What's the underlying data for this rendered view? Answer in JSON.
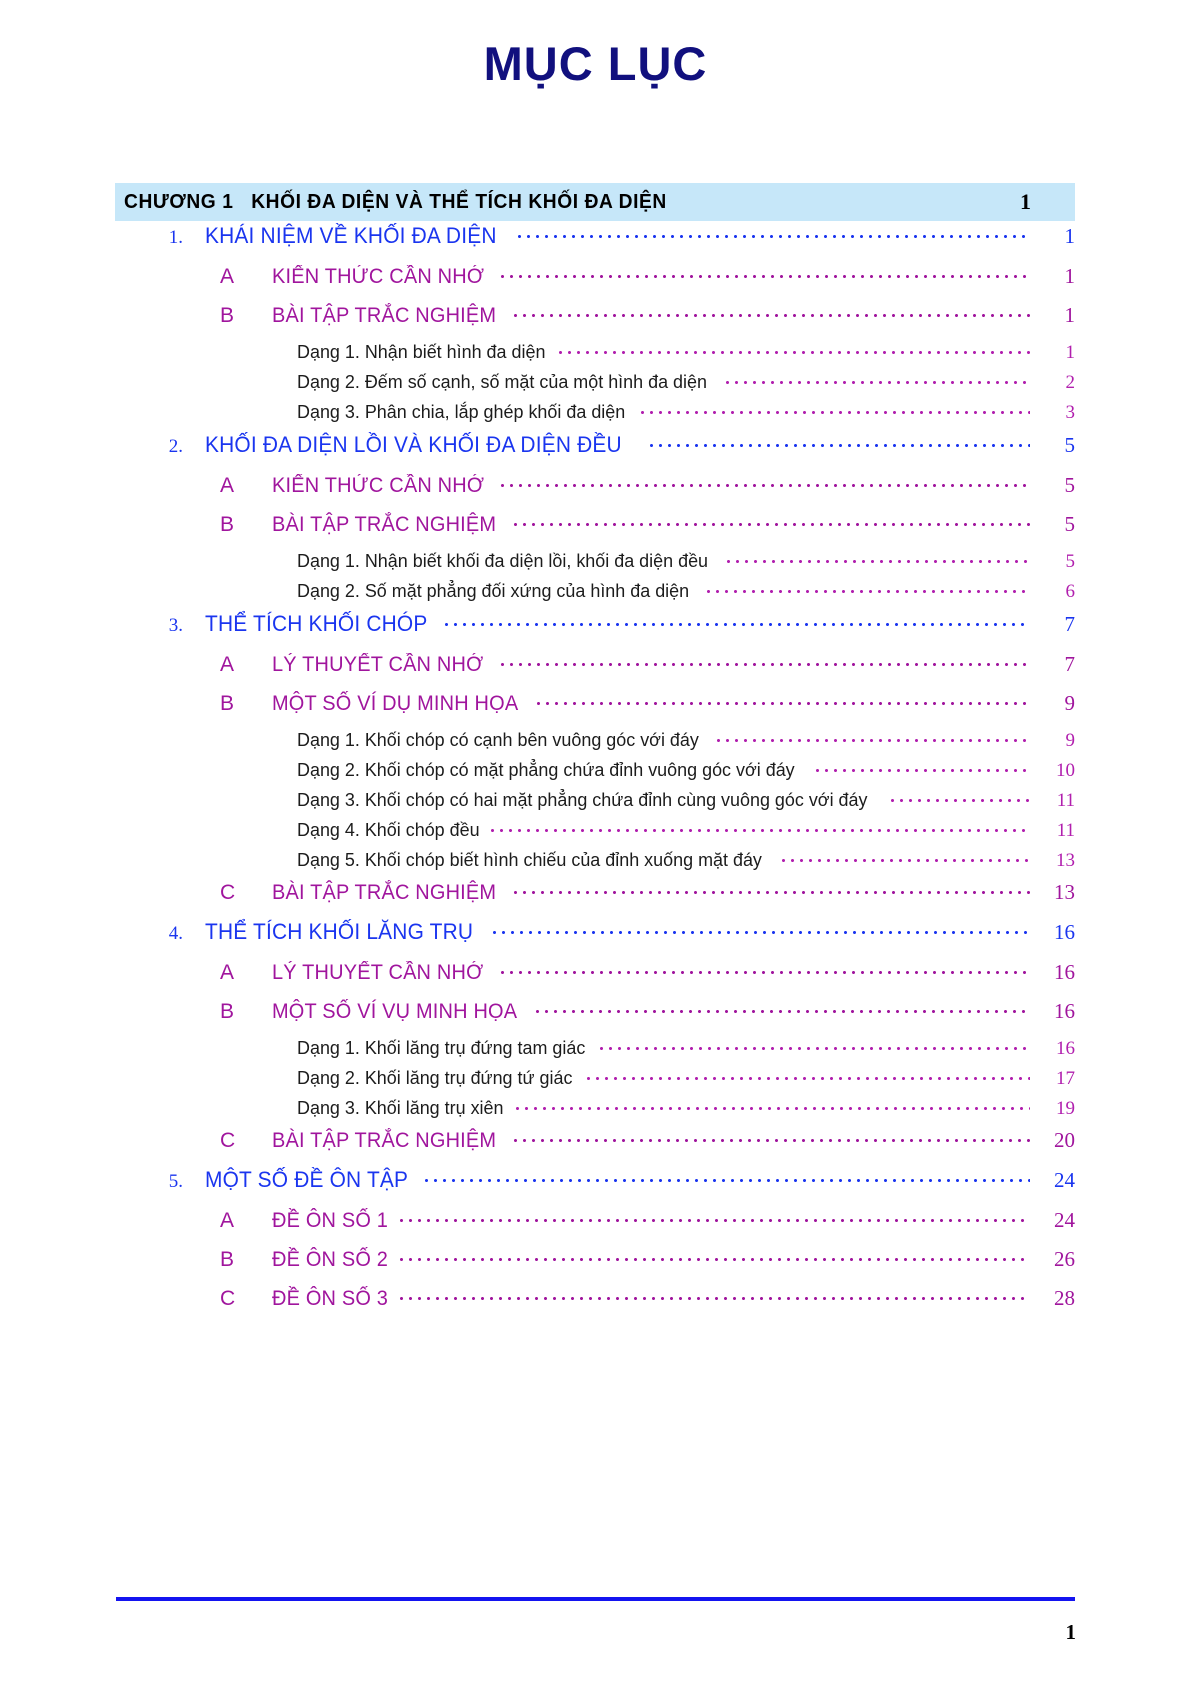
{
  "document": {
    "title": "MỤC LỤC",
    "title_color": "#11107e",
    "footer_page_number": "1",
    "rule_color": "#1414f0"
  },
  "colors": {
    "chapter_bar_background": "#c6e7f9",
    "chapter_text": "#000000",
    "level1": "#1a35ef",
    "level2": "#a0159d",
    "level3_text": "#1c1c1c",
    "level3_leader": "#b11fae"
  },
  "chapter": {
    "label": "CHƯƠNG 1   KHỐI ĐA DIỆN VÀ THỂ TÍCH KHỐI ĐA DIỆN",
    "page": "1"
  },
  "entries": [
    {
      "level": 1,
      "num": "1.",
      "text": "KHÁI NIỆM VỀ KHỐI ĐA DIỆN",
      "page": "1"
    },
    {
      "level": 2,
      "num": "A",
      "text": "KIẾN THỨC CẦN NHỚ",
      "page": "1"
    },
    {
      "level": 2,
      "num": "B",
      "text": "BÀI TẬP TRẮC NGHIỆM",
      "page": "1"
    },
    {
      "level": 3,
      "num": "",
      "text": "Dạng 1. Nhận biết hình đa diện",
      "page": "1"
    },
    {
      "level": 3,
      "num": "",
      "text": "Dạng 2. Đếm số cạnh, số mặt của một hình đa diện",
      "page": "2"
    },
    {
      "level": 3,
      "num": "",
      "text": "Dạng 3. Phân chia, lắp ghép khối đa diện",
      "page": "3"
    },
    {
      "level": 1,
      "num": "2.",
      "text": "KHỐI ĐA DIỆN LỒI VÀ KHỐI ĐA DIỆN ĐỀU",
      "page": "5"
    },
    {
      "level": 2,
      "num": "A",
      "text": "KIẾN THỨC CẦN NHỚ",
      "page": "5"
    },
    {
      "level": 2,
      "num": "B",
      "text": "BÀI TẬP TRẮC NGHIỆM",
      "page": "5"
    },
    {
      "level": 3,
      "num": "",
      "text": "Dạng 1. Nhận biết khối đa diện lồi, khối đa diện đều",
      "page": "5"
    },
    {
      "level": 3,
      "num": "",
      "text": "Dạng 2. Số mặt phẳng đối xứng của hình đa diện",
      "page": "6"
    },
    {
      "level": 1,
      "num": "3.",
      "text": "THỂ TÍCH KHỐI CHÓP",
      "page": "7"
    },
    {
      "level": 2,
      "num": "A",
      "text": "LÝ THUYẾT CẦN NHỚ",
      "page": "7"
    },
    {
      "level": 2,
      "num": "B",
      "text": "MỘT SỐ VÍ DỤ MINH HỌA",
      "page": "9"
    },
    {
      "level": 3,
      "num": "",
      "text": "Dạng 1. Khối chóp có cạnh bên vuông góc với đáy",
      "page": "9"
    },
    {
      "level": 3,
      "num": "",
      "text": "Dạng 2. Khối chóp có mặt phẳng chứa đỉnh vuông góc với đáy",
      "page": "10"
    },
    {
      "level": 3,
      "num": "",
      "text": "Dạng 3. Khối chóp có hai mặt phẳng chứa đỉnh cùng vuông góc với đáy",
      "page": "11"
    },
    {
      "level": 3,
      "num": "",
      "text": "Dạng 4. Khối chóp đều",
      "page": "11"
    },
    {
      "level": 3,
      "num": "",
      "text": "Dạng 5. Khối chóp biết hình chiếu của đỉnh xuống mặt đáy",
      "page": "13"
    },
    {
      "level": 2,
      "num": "C",
      "text": "BÀI TẬP TRẮC NGHIỆM",
      "page": "13"
    },
    {
      "level": 1,
      "num": "4.",
      "text": "THỂ TÍCH KHỐI LĂNG TRỤ",
      "page": "16"
    },
    {
      "level": 2,
      "num": "A",
      "text": "LÝ THUYẾT CẦN NHỚ",
      "page": "16"
    },
    {
      "level": 2,
      "num": "B",
      "text": "MỘT SỐ VÍ VỤ MINH HỌA",
      "page": "16"
    },
    {
      "level": 3,
      "num": "",
      "text": "Dạng 1. Khối lăng trụ đứng tam giác",
      "page": "16"
    },
    {
      "level": 3,
      "num": "",
      "text": "Dạng 2. Khối lăng trụ đứng tứ giác",
      "page": "17"
    },
    {
      "level": 3,
      "num": "",
      "text": "Dạng 3. Khối lăng trụ xiên",
      "page": "19"
    },
    {
      "level": 2,
      "num": "C",
      "text": "BÀI TẬP TRẮC NGHIỆM",
      "page": "20"
    },
    {
      "level": 1,
      "num": "5.",
      "text": "MỘT SỐ ĐỀ ÔN TẬP",
      "page": "24"
    },
    {
      "level": 2,
      "num": "A",
      "text": "ĐỀ ÔN SỐ 1",
      "page": "24"
    },
    {
      "level": 2,
      "num": "B",
      "text": "ĐỀ ÔN SỐ 2",
      "page": "26"
    },
    {
      "level": 2,
      "num": "C",
      "text": "ĐỀ ÔN SỐ 3",
      "page": "28"
    }
  ]
}
